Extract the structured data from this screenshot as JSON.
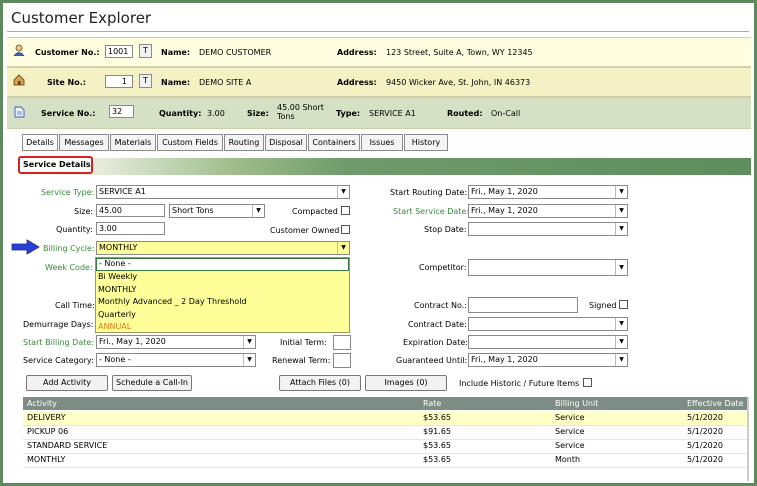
{
  "title": "Customer Explorer",
  "customer": {
    "label": "Customer No.:",
    "number": "1001",
    "t_button": "T",
    "name_label": "Name:",
    "name": "DEMO CUSTOMER",
    "address_label": "Address:",
    "address": "123 Street, Suite A, Town, WY 12345"
  },
  "site": {
    "label": "Site No.:",
    "number": "1",
    "t_button": "T",
    "name_label": "Name:",
    "name": "DEMO SITE A",
    "address_label": "Address:",
    "address": "9450 Wicker Ave, St. John, IN 46373"
  },
  "service": {
    "label": "Service No.:",
    "number": "32",
    "quantity_label": "Quantity:",
    "quantity": "3.00",
    "size_label": "Size:",
    "size": "45.00 Short Tons",
    "type_label": "Type:",
    "type": "SERVICE A1",
    "routed_label": "Routed:",
    "routed": "On-Call"
  },
  "tabs": [
    "Details",
    "Messages",
    "Materials",
    "Custom Fields",
    "Routing",
    "Disposal",
    "Containers",
    "Issues",
    "History"
  ],
  "section_title": "Service Details",
  "form": {
    "service_type_label": "Service Type:",
    "service_type": "SERVICE A1",
    "size_label": "Size:",
    "size": "45.00",
    "size_unit": "Short Tons",
    "compacted_label": "Compacted",
    "quantity_label": "Quantity:",
    "quantity": "3.00",
    "customer_owned_label": "Customer Owned",
    "billing_cycle_label": "Billing Cycle:",
    "billing_cycle": "MONTHLY",
    "week_code_label": "Week Code:",
    "call_time_label": "Call Time:",
    "demurrage_label": "Demurrage Days:",
    "start_billing_label": "Start Billing Date:",
    "start_billing": "Fri., May 1, 2020",
    "initial_term_label": "Initial Term:",
    "service_category_label": "Service Category:",
    "service_category": "- None -",
    "renewal_term_label": "Renewal Term:",
    "start_routing_label": "Start Routing Date:",
    "start_routing": "Fri., May 1, 2020",
    "start_service_label": "Start Service Date:",
    "start_service": "Fri., May 1, 2020",
    "stop_date_label": "Stop Date:",
    "competitor_label": "Competitor:",
    "contract_no_label": "Contract No.:",
    "signed_label": "Signed",
    "contract_date_label": "Contract Date:",
    "expiration_label": "Expiration Date:",
    "guaranteed_label": "Guaranteed Until:",
    "guaranteed": "Fri., May 1, 2020"
  },
  "billing_options": [
    "- None -",
    "Bi Weekly",
    "MONTHLY",
    "Monthly Advanced _ 2 Day Threshold",
    "Quarterly",
    "ANNUAL"
  ],
  "buttons": {
    "add_activity": "Add Activity",
    "schedule": "Schedule a Call-In",
    "attach": "Attach Files (0)",
    "images": "Images (0)",
    "include_historic": "Include Historic / Future Items"
  },
  "grid": {
    "headers": [
      "Activity",
      "Rate",
      "Billing Unit",
      "Effective Date"
    ],
    "rows": [
      [
        "DELIVERY",
        "$53.65",
        "Service",
        "5/1/2020"
      ],
      [
        "PICKUP 06",
        "$91.65",
        "Service",
        "5/1/2020"
      ],
      [
        "STANDARD SERVICE",
        "$53.65",
        "Service",
        "5/1/2020"
      ],
      [
        "MONTHLY",
        "$53.65",
        "Month",
        "5/1/2020"
      ]
    ]
  },
  "colors": {
    "frame": "#5c8a5c",
    "green_label": "#3a8a3a",
    "dropdown_bg": "#ffff9a",
    "highlight_row": "#ffffc8",
    "grid_header": "#7d8c84",
    "arrow": "#2a3fd6"
  }
}
